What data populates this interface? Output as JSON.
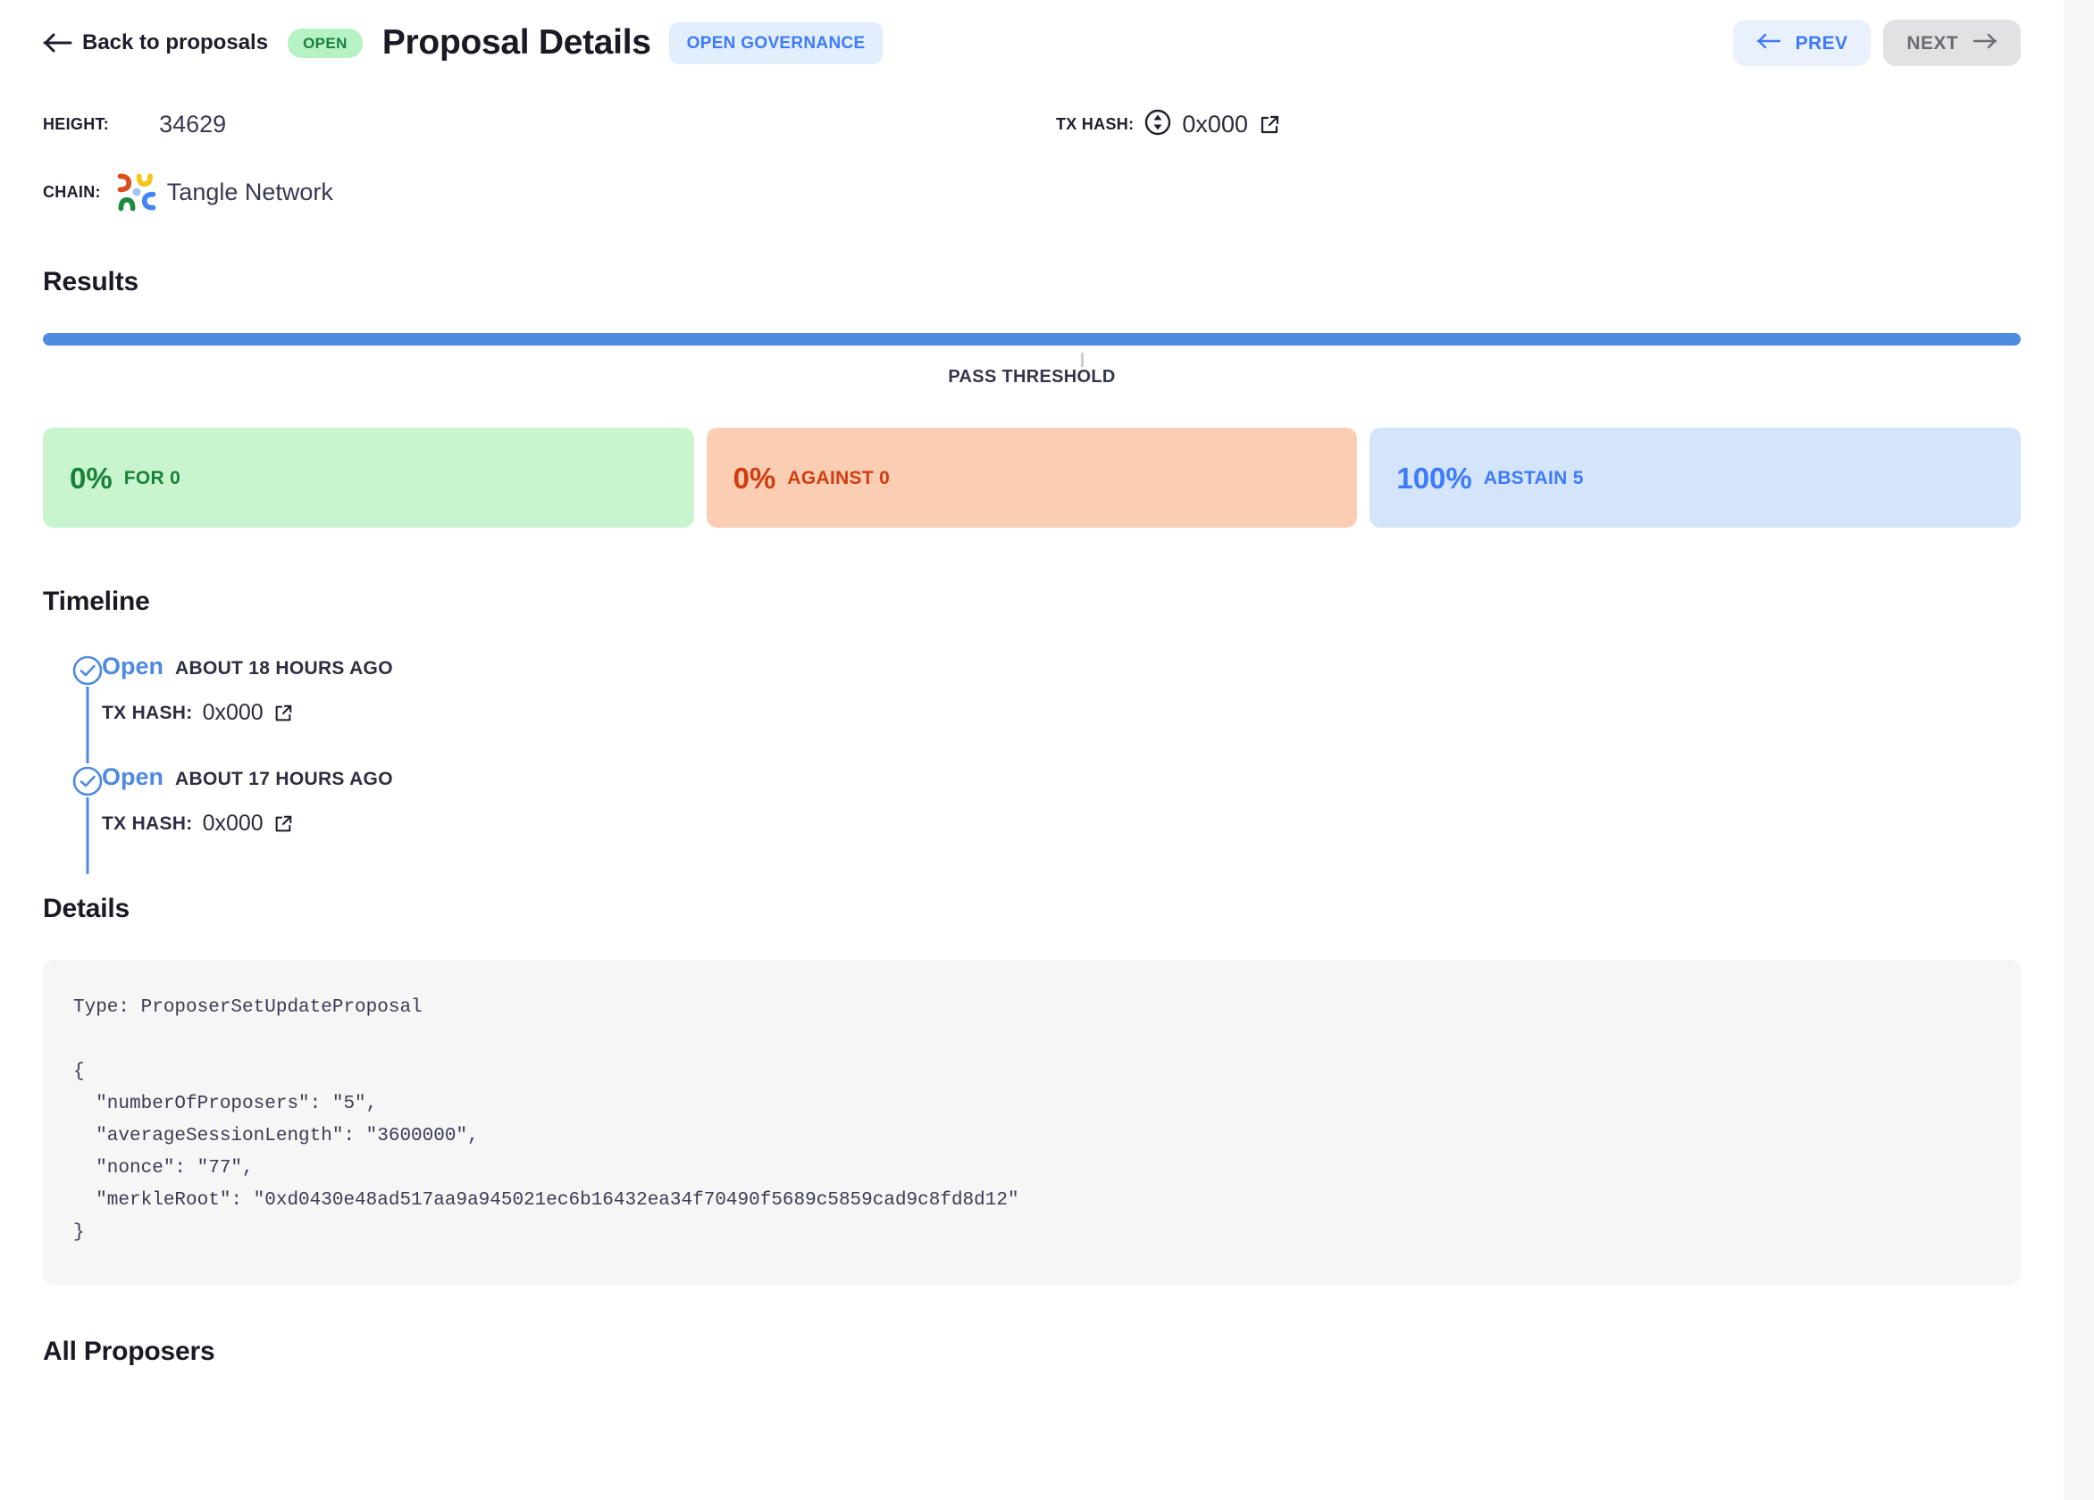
{
  "header": {
    "back_label": "Back to proposals",
    "status_badge": "OPEN",
    "title": "Proposal Details",
    "category_badge": "OPEN GOVERNANCE",
    "prev_label": "PREV",
    "next_label": "NEXT"
  },
  "meta": {
    "height_label": "HEIGHT:",
    "height_value": "34629",
    "tx_hash_label": "TX HASH:",
    "tx_hash_value": "0x000",
    "chain_label": "CHAIN:",
    "chain_value": "Tangle Network"
  },
  "results": {
    "title": "Results",
    "progress_percent": 100,
    "threshold_percent": 52.5,
    "threshold_label": "PASS THRESHOLD",
    "cards": [
      {
        "percent": "0%",
        "label": "FOR 0"
      },
      {
        "percent": "0%",
        "label": "AGAINST 0"
      },
      {
        "percent": "100%",
        "label": "ABSTAIN 5"
      }
    ]
  },
  "timeline": {
    "title": "Timeline",
    "items": [
      {
        "status": "Open",
        "time": "ABOUT 18 HOURS AGO",
        "tx_label": "TX HASH:",
        "tx_value": "0x000"
      },
      {
        "status": "Open",
        "time": "ABOUT 17 HOURS AGO",
        "tx_label": "TX HASH:",
        "tx_value": "0x000"
      }
    ]
  },
  "details": {
    "title": "Details",
    "code": "Type: ProposerSetUpdateProposal\n\n{\n  \"numberOfProposers\": \"5\",\n  \"averageSessionLength\": \"3600000\",\n  \"nonce\": \"77\",\n  \"merkleRoot\": \"0xd0430e48ad517aa9a945021ec6b16432ea34f70490f5689c5859cad9c8fd8d12\"\n}"
  },
  "proposers": {
    "title": "All Proposers"
  },
  "colors": {
    "accent_blue": "#3d7bfb",
    "progress_blue": "#4d8bdf",
    "for_green": "#18803a",
    "against_orange": "#d13d10",
    "abstain_blue": "#3d7bfb",
    "open_badge_bg": "#b6f2c4"
  },
  "icons": {
    "back_arrow": "arrow-left-icon",
    "prev_arrow": "arrow-left-icon",
    "next_arrow": "arrow-right-icon",
    "tx_swap": "swap-vertical-circle-icon",
    "external_link": "external-link-icon",
    "chain_logo": "tangle-network-logo-icon",
    "timeline_check": "check-circle-icon"
  }
}
